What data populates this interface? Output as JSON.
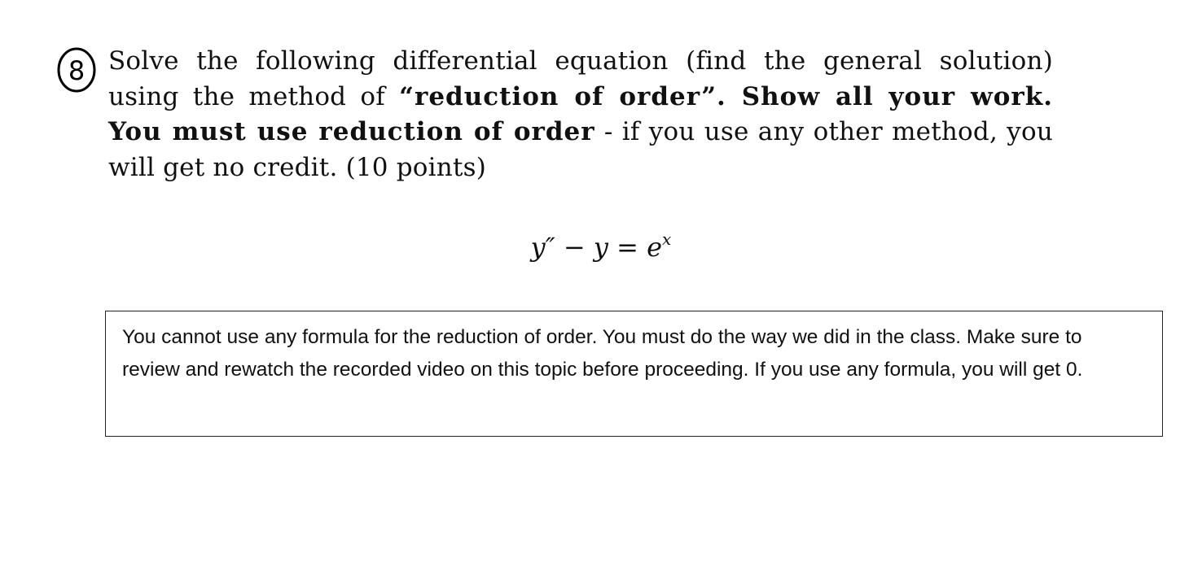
{
  "question": {
    "number": "8",
    "segments": [
      {
        "text": "Solve the following differential equation (find the general solution) using the method of ",
        "bold": false
      },
      {
        "text": "“reduction of order”. Show all your work. You must use reduction of order",
        "bold": true
      },
      {
        "text": " - if you use any other method, you will get no credit. (10 points)",
        "bold": false
      }
    ],
    "equation": {
      "lhs": "y″ − y = e",
      "exponent": "x"
    }
  },
  "note": {
    "text": "You cannot use any formula for the reduction of order. You must do the way we did in the class. Make sure to review and rewatch the recorded video on this topic before proceeding. If you use any formula, you will get 0."
  }
}
